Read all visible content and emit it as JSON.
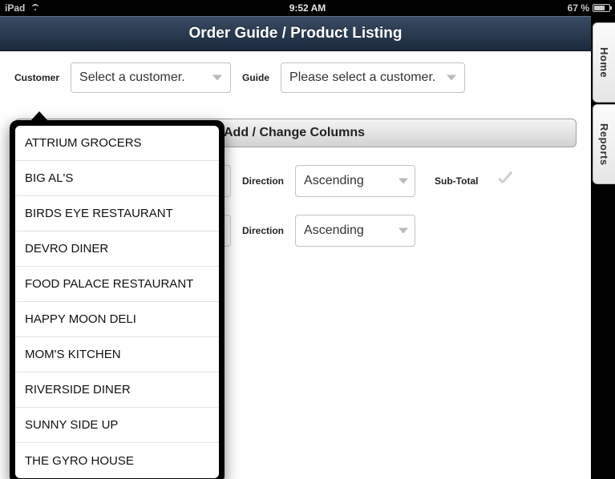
{
  "statusbar": {
    "device": "iPad",
    "time": "9:52 AM",
    "battery_pct": "67 %"
  },
  "tabs": {
    "home": "Home",
    "reports": "Reports"
  },
  "header": {
    "title": "Order Guide / Product Listing"
  },
  "filters": {
    "customer_label": "Customer",
    "customer_select": "Select a customer.",
    "guide_label": "Guide",
    "guide_select": "Please select a customer."
  },
  "addcol_label": "Add / Change Columns",
  "sort": {
    "direction_label": "Direction",
    "rows": [
      {
        "direction": "Ascending"
      },
      {
        "direction": "Ascending"
      }
    ],
    "subtotal_label": "Sub-Total"
  },
  "customer_popover": [
    "ATTRIUM GROCERS",
    "BIG AL'S",
    "BIRDS EYE RESTAURANT",
    "DEVRO DINER",
    "FOOD PALACE RESTAURANT",
    "HAPPY MOON DELI",
    "MOM'S KITCHEN",
    "RIVERSIDE DINER",
    "SUNNY SIDE UP",
    "THE GYRO HOUSE"
  ]
}
